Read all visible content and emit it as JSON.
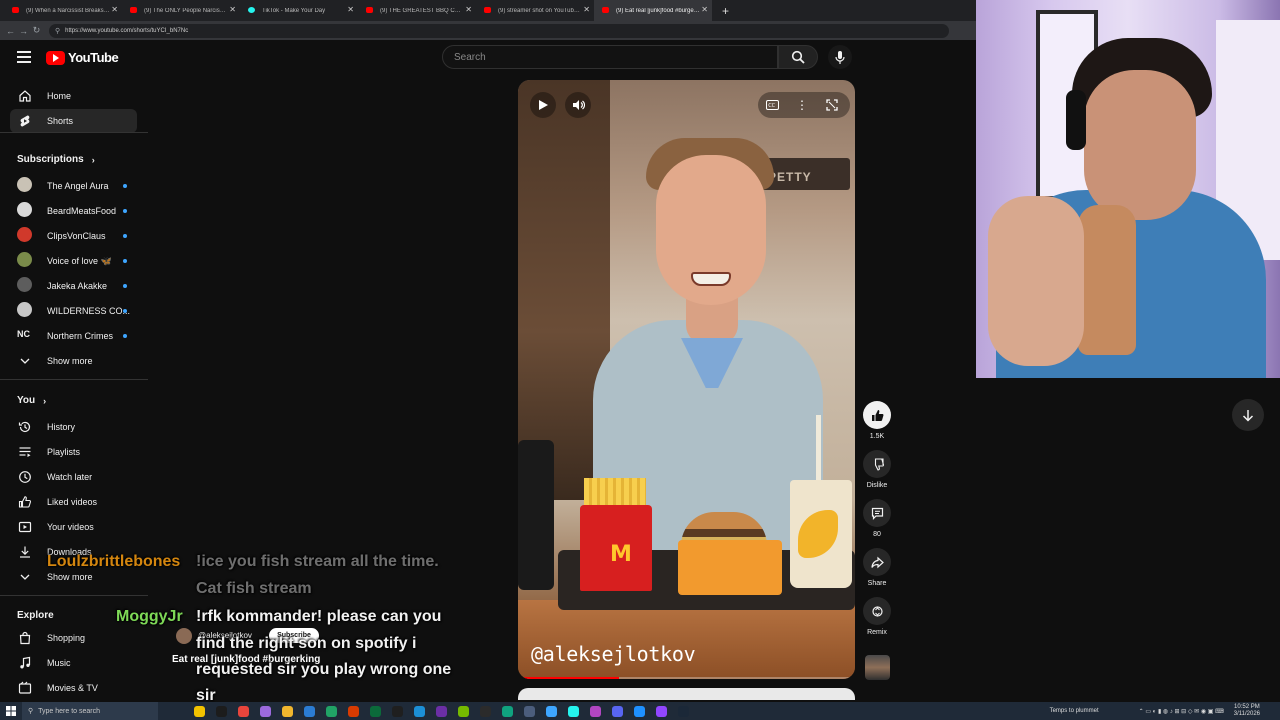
{
  "browser": {
    "tabs": [
      {
        "title": "(9) When a Narcissist Breaks the",
        "favicon": "youtube",
        "active": false
      },
      {
        "title": "(9) The ONLY People Narcissists",
        "favicon": "youtube",
        "active": false
      },
      {
        "title": "TikTok - Make Your Day",
        "favicon": "tiktok",
        "active": false
      },
      {
        "title": "(9) THE GREATEST BBQ CHALLEN",
        "favicon": "youtube",
        "active": false
      },
      {
        "title": "(9) streamer shot on YouTube live",
        "favicon": "youtube",
        "active": false
      },
      {
        "title": "(9) Eat real [junk]food #burgerking",
        "favicon": "youtube",
        "active": true
      }
    ],
    "url": "https://www.youtube.com/shorts/tuYCI_bN7Nc"
  },
  "header": {
    "logo_text": "YouTube",
    "search_placeholder": "Search"
  },
  "sidebar": {
    "main": [
      {
        "label": "Home",
        "icon": "home-icon"
      },
      {
        "label": "Shorts",
        "icon": "shorts-icon",
        "active": true
      }
    ],
    "subscriptions_heading": "Subscriptions",
    "subscriptions": [
      {
        "label": "The Angel Aura",
        "color": "#c9c2b5"
      },
      {
        "label": "BeardMeatsFood",
        "color": "#d9d9d9"
      },
      {
        "label": "ClipsVonClaus",
        "color": "#d0392b"
      },
      {
        "label": "Voice of love 🦋",
        "color": "#7a8b4a"
      },
      {
        "label": "Jakeka Akakke",
        "color": "#5d5d5d"
      },
      {
        "label": "WILDERNESS CO...",
        "color": "#c7c7c7"
      },
      {
        "label": "Northern Crimes",
        "color": "#222222",
        "initials": "NC"
      }
    ],
    "subscriptions_more": "Show more",
    "you_heading": "You",
    "you": [
      {
        "label": "History",
        "icon": "history-icon"
      },
      {
        "label": "Playlists",
        "icon": "playlists-icon"
      },
      {
        "label": "Watch later",
        "icon": "watch-later-icon"
      },
      {
        "label": "Liked videos",
        "icon": "liked-icon"
      },
      {
        "label": "Your videos",
        "icon": "your-videos-icon"
      },
      {
        "label": "Downloads",
        "icon": "downloads-icon"
      }
    ],
    "you_more": "Show more",
    "explore_heading": "Explore",
    "explore": [
      {
        "label": "Shopping",
        "icon": "shopping-icon"
      },
      {
        "label": "Music",
        "icon": "music-icon"
      },
      {
        "label": "Movies & TV",
        "icon": "movies-icon"
      }
    ]
  },
  "short": {
    "sign_text": "PETTY",
    "watermark": "@aleksejlotkov",
    "progress": 0.3,
    "channel": "@aleksejlotkov",
    "subscribe_label": "Subscribe",
    "title": "Eat real [junk]food #burgerking",
    "actions": {
      "like_count": "1.5K",
      "dislike_label": "Dislike",
      "comments_count": "80",
      "share_label": "Share",
      "remix_label": "Remix"
    }
  },
  "chat": [
    {
      "user": "Loulzbrittlebones",
      "user_color": "#d4860f",
      "lines": [
        "!ice you fish stream all the time.",
        "Cat fish stream"
      ]
    },
    {
      "user": "MoggyJr",
      "user_color": "#7ed957",
      "lines": [
        "!rfk kommander! please can you",
        "find the right son on spotify i",
        "requested sir you play wrong one",
        "sir"
      ]
    }
  ],
  "taskbar": {
    "search_placeholder": "Type here to search",
    "weather": "Temps to plummet",
    "time": "10:52 PM",
    "date": "3/11/2026",
    "app_colors": [
      "#f2c200",
      "#1c1c1c",
      "#e8453c",
      "#9c6ade",
      "#f0b62e",
      "#2b7cd3",
      "#21a366",
      "#d83b01",
      "#0b6a3a",
      "#1f1f1f",
      "#1c8fd6",
      "#6b2fa5",
      "#76b900",
      "#2b2b2b",
      "#10a37f",
      "#4b5d7c",
      "#3ea6ff",
      "#25f4ee",
      "#b146c2",
      "#5865f2",
      "#1e90ff",
      "#9146ff",
      "#1b2838"
    ]
  }
}
